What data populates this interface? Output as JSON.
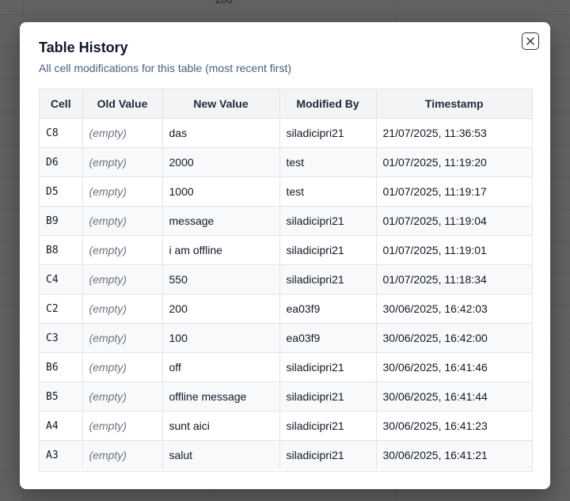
{
  "background": {
    "partial_cell_text": "200"
  },
  "modal": {
    "title": "Table History",
    "subtitle": "All cell modifications for this table (most recent first)",
    "close_icon": "close-icon"
  },
  "table": {
    "headers": [
      "Cell",
      "Old Value",
      "New Value",
      "Modified By",
      "Timestamp"
    ],
    "rows": [
      {
        "cell": "C8",
        "old": "(empty)",
        "new": "das",
        "by": "siladicipri21",
        "ts": "21/07/2025, 11:36:53"
      },
      {
        "cell": "D6",
        "old": "(empty)",
        "new": "2000",
        "by": "test",
        "ts": "01/07/2025, 11:19:20"
      },
      {
        "cell": "D5",
        "old": "(empty)",
        "new": "1000",
        "by": "test",
        "ts": "01/07/2025, 11:19:17"
      },
      {
        "cell": "B9",
        "old": "(empty)",
        "new": "message",
        "by": "siladicipri21",
        "ts": "01/07/2025, 11:19:04"
      },
      {
        "cell": "B8",
        "old": "(empty)",
        "new": "i am offline",
        "by": "siladicipri21",
        "ts": "01/07/2025, 11:19:01"
      },
      {
        "cell": "C4",
        "old": "(empty)",
        "new": "550",
        "by": "siladicipri21",
        "ts": "01/07/2025, 11:18:34"
      },
      {
        "cell": "C2",
        "old": "(empty)",
        "new": "200",
        "by": "ea03f9",
        "ts": "30/06/2025, 16:42:03"
      },
      {
        "cell": "C3",
        "old": "(empty)",
        "new": "100",
        "by": "ea03f9",
        "ts": "30/06/2025, 16:42:00"
      },
      {
        "cell": "B6",
        "old": "(empty)",
        "new": "off",
        "by": "siladicipri21",
        "ts": "30/06/2025, 16:41:46"
      },
      {
        "cell": "B5",
        "old": "(empty)",
        "new": "offline message",
        "by": "siladicipri21",
        "ts": "30/06/2025, 16:41:44"
      },
      {
        "cell": "A4",
        "old": "(empty)",
        "new": "sunt aici",
        "by": "siladicipri21",
        "ts": "30/06/2025, 16:41:23"
      },
      {
        "cell": "A3",
        "old": "(empty)",
        "new": "salut",
        "by": "siladicipri21",
        "ts": "30/06/2025, 16:41:21"
      }
    ]
  }
}
